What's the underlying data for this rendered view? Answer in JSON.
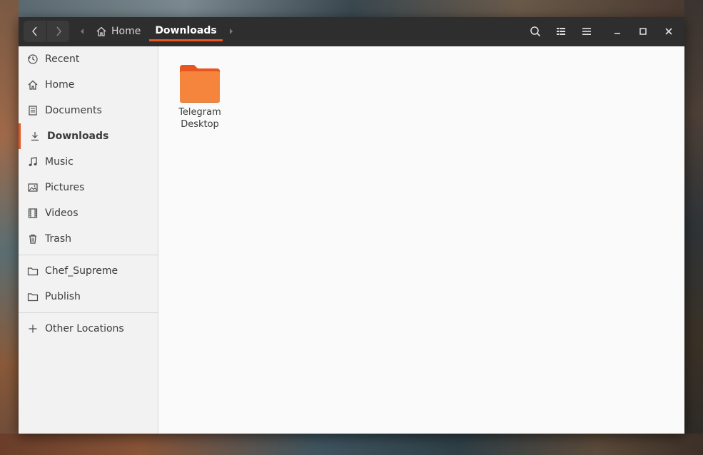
{
  "window": {
    "breadcrumb": [
      "Home",
      "Downloads"
    ],
    "accent_color": "#e95420",
    "headerbar_color": "#2e2e2e"
  },
  "toolbar": {
    "back_icon": "chevron-left-icon",
    "forward_icon": "chevron-right-icon",
    "search_icon": "search-icon",
    "view_icon": "list-view-icon",
    "menu_icon": "hamburger-menu-icon",
    "minimize_icon": "minimize-icon",
    "maximize_icon": "maximize-icon",
    "close_icon": "close-icon"
  },
  "sidebar": {
    "places": [
      {
        "label": "Recent",
        "icon": "clock-icon"
      },
      {
        "label": "Home",
        "icon": "home-icon"
      },
      {
        "label": "Documents",
        "icon": "document-icon"
      },
      {
        "label": "Downloads",
        "icon": "download-icon",
        "active": true
      },
      {
        "label": "Music",
        "icon": "music-note-icon"
      },
      {
        "label": "Pictures",
        "icon": "picture-icon"
      },
      {
        "label": "Videos",
        "icon": "film-icon"
      },
      {
        "label": "Trash",
        "icon": "trash-icon"
      }
    ],
    "bookmarks": [
      {
        "label": "Chef_Supreme",
        "icon": "folder-icon"
      },
      {
        "label": "Publish",
        "icon": "folder-icon"
      }
    ],
    "other": {
      "label": "Other Locations",
      "icon": "plus-icon"
    }
  },
  "content": {
    "files": [
      {
        "name": "Telegram Desktop",
        "type": "folder",
        "color": "#f57e3c"
      }
    ]
  }
}
